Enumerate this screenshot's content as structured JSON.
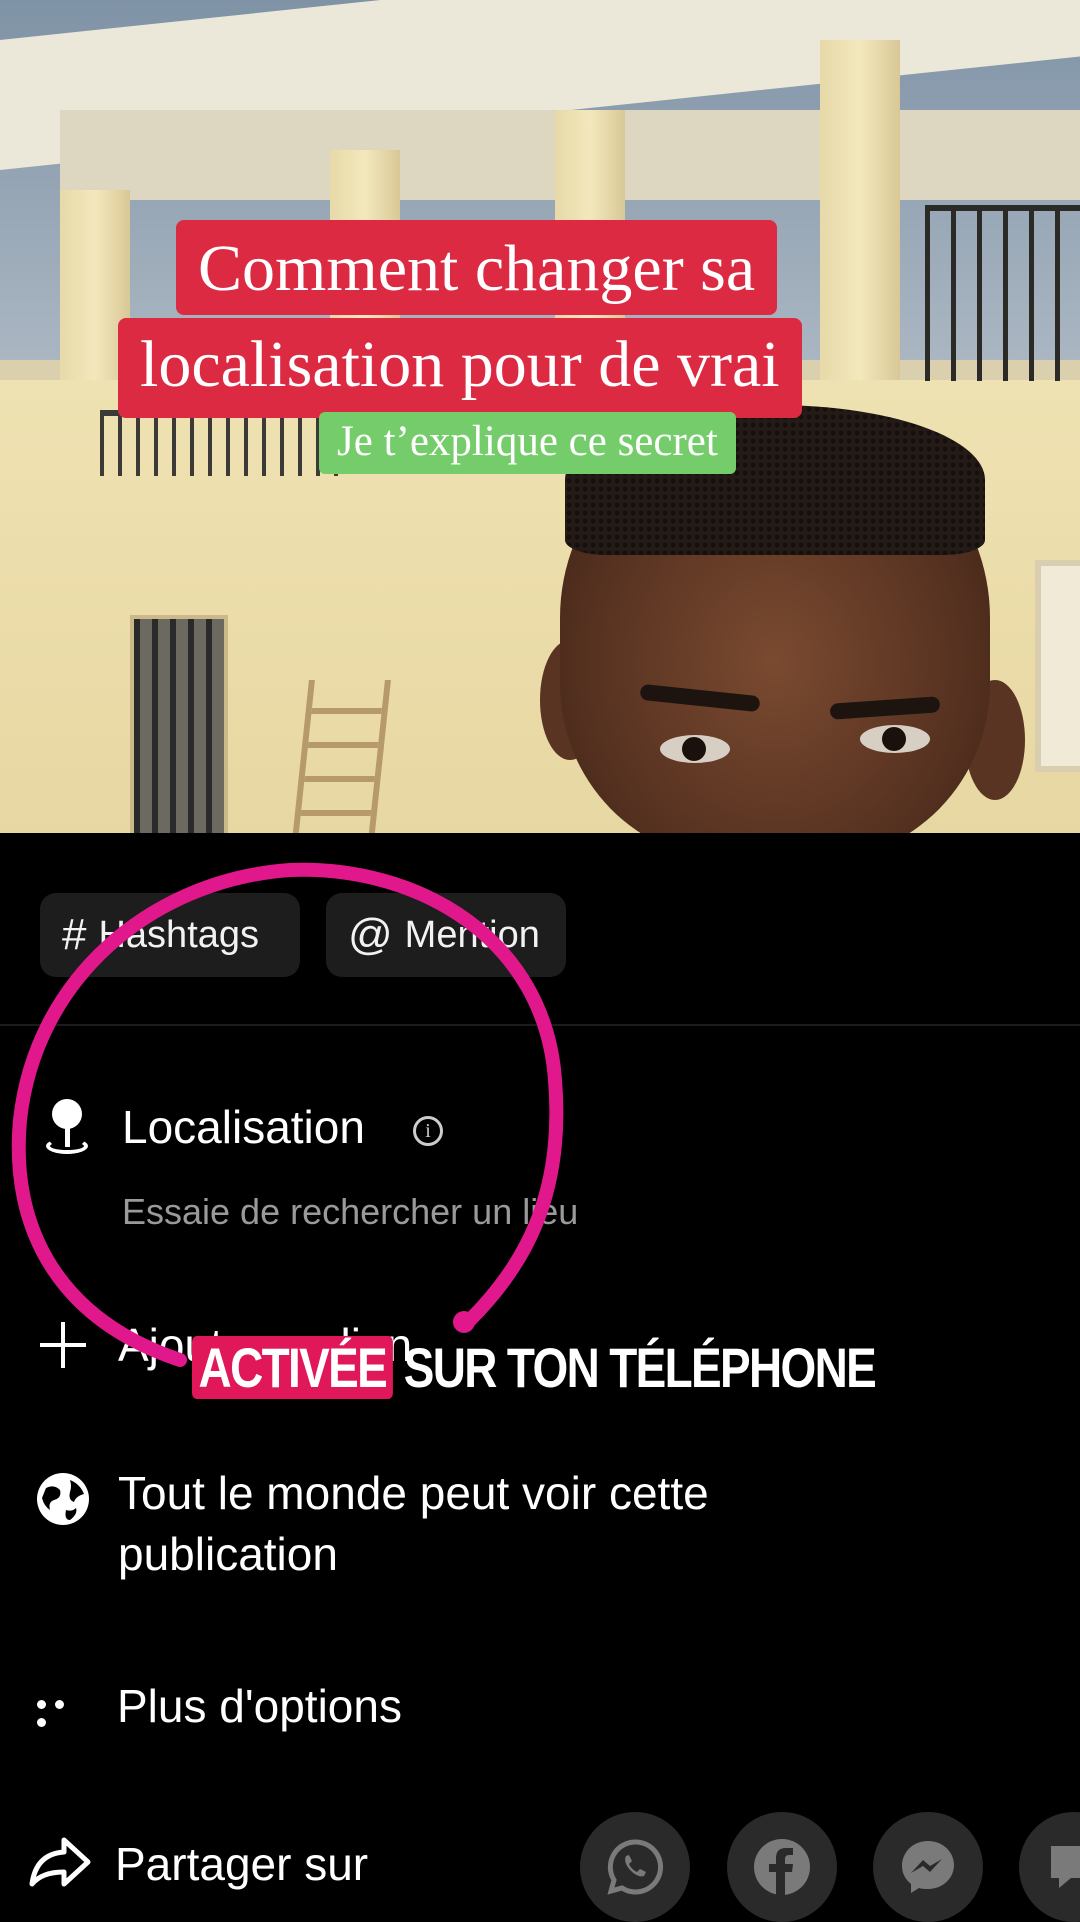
{
  "overlay": {
    "title_line1": "Comment changer sa",
    "title_line2": "localisation pour de vrai",
    "subtitle": "Je t’explique ce secret",
    "caption_highlight": "ACTIVÉE",
    "caption_rest": "SUR TON TÉLÉPHONE",
    "title_color": "#dc2a43",
    "subtitle_color": "#74cc6a",
    "annotation_color": "#e0188c"
  },
  "tags": {
    "hashtags": {
      "symbol": "#",
      "label": "Hashtags"
    },
    "mention": {
      "symbol": "@",
      "label": "Mention"
    }
  },
  "menu": {
    "location": {
      "title": "Localisation",
      "placeholder": "Essaie de rechercher un lieu",
      "icon": "location-pin-icon"
    },
    "add_link": {
      "title": "Ajouter un lien",
      "icon": "plus-icon"
    },
    "visibility": {
      "line1": "Tout le monde peut voir cette",
      "line2": "publication",
      "icon": "globe-icon"
    },
    "more_options": {
      "title": "Plus d'options",
      "icon": "more-dots-icon"
    },
    "share": {
      "title": "Partager sur",
      "icon": "share-arrow-icon"
    }
  },
  "share_targets": [
    "whatsapp-icon",
    "facebook-icon",
    "messenger-icon",
    "message-icon"
  ]
}
